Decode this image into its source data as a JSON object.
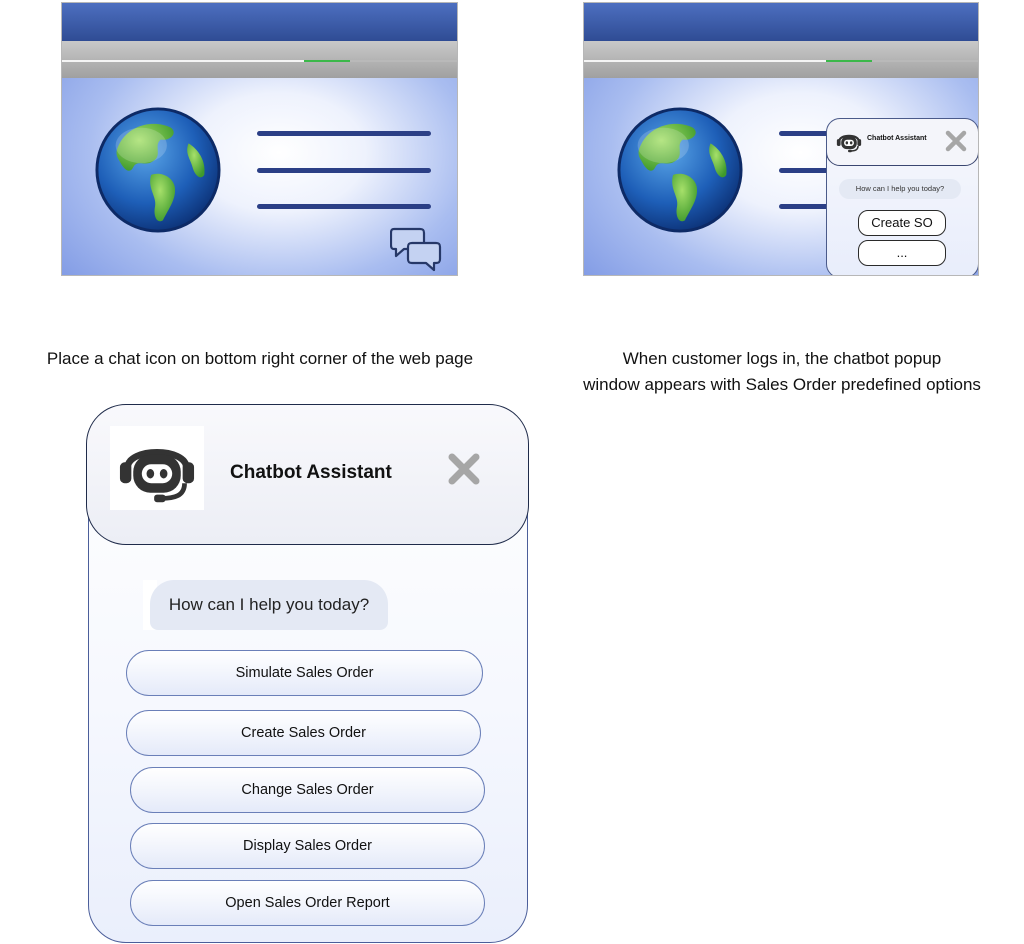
{
  "captions": {
    "left": "Place a chat icon on bottom right corner of the web page",
    "right_line1": "When customer logs in, the chatbot popup",
    "right_line2": "window appears with Sales Order predefined options"
  },
  "mini_popup": {
    "title": "Chatbot Assistant",
    "prompt": "How can I help you today?",
    "buttons": [
      "Create SO",
      "..."
    ]
  },
  "chatbot": {
    "title": "Chatbot Assistant",
    "prompt": "How can I help you today?",
    "options": [
      "Simulate Sales Order",
      "Create Sales Order",
      "Change Sales Order",
      "Display Sales Order",
      "Open Sales Order Report"
    ]
  },
  "icons": {
    "chat": "chat-bubbles-icon",
    "bot": "robot-headset-icon",
    "close": "close-x-icon",
    "globe": "globe-icon"
  },
  "colors": {
    "header_blue": "#2f4c94",
    "text_line": "#2b3f86",
    "close_grey": "#a6a6a6",
    "button_border": "#6a7fb8"
  }
}
